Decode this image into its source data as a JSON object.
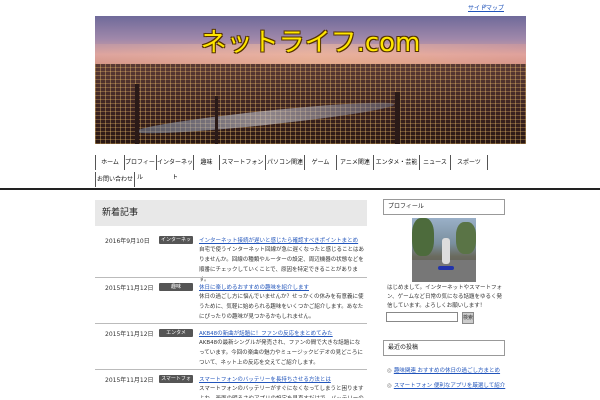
{
  "top": {
    "sitemap_label": "サイトマップ"
  },
  "header": {
    "site_title": "ネットライフ.com"
  },
  "nav": {
    "items": [
      "ホーム",
      "プロフィール",
      "インターネット",
      "趣味",
      "スマートフォン",
      "パソコン関連",
      "ゲーム",
      "アニメ関連",
      "エンタメ・芸能",
      "ニュース",
      "スポーツ",
      "お問い合わせ"
    ]
  },
  "main": {
    "heading": "新着記事",
    "posts": [
      {
        "date": "2016年9月10日",
        "category": "インターネット",
        "title": "インターネット接続が遅いと感じたら確認すべきポイントまとめ",
        "excerpt": "自宅で使うインターネット回線が急に遅くなったと感じることはありませんか。回線の種類やルーターの設定、周辺機器の状態などを順番にチェックしていくことで、原因を特定できることがあります。"
      },
      {
        "date": "2015年11月12日",
        "category": "趣味",
        "title": "休日に楽しめるおすすめの趣味を紹介します",
        "excerpt": "休日の過ごし方に悩んでいませんか？せっかくの休みを有意義に使うために、気軽に始められる趣味をいくつかご紹介します。あなたにぴったりの趣味が見つかるかもしれません。"
      },
      {
        "date": "2015年11月12日",
        "category": "エンタメ",
        "title": "AKB48の新曲が話題に！ファンの反応をまとめてみた",
        "excerpt": "AKB48の最新シングルが発売され、ファンの間で大きな話題になっています。今回の楽曲の魅力やミュージックビデオの見どころについて、ネット上の反応を交えてご紹介します。"
      },
      {
        "date": "2015年11月12日",
        "category": "スマートフォン",
        "title": "スマートフォンのバッテリーを長持ちさせる方法とは",
        "excerpt": "スマートフォンのバッテリーがすぐになくなってしまうと困りますよね。画面の明るさやアプリの設定を見直すだけで、バッテリーの持ちを大きく改善することができます。"
      }
    ]
  },
  "sidebar": {
    "profile_heading": "プロフィール",
    "profile_text": "はじめまして。インターネットやスマートフォン、ゲームなど日常の気になる話題をゆるく発信しています。よろしくお願いします！",
    "search_button": "検索",
    "recent_heading": "最近の投稿",
    "recent_items": [
      "趣味関連 おすすめの休日の過ごし方まとめ",
      "スマートフォン 便利なアプリを厳選して紹介"
    ]
  },
  "colors": {
    "accent": "#ffe600",
    "link": "#2255bb",
    "category_badge": "#555555"
  }
}
